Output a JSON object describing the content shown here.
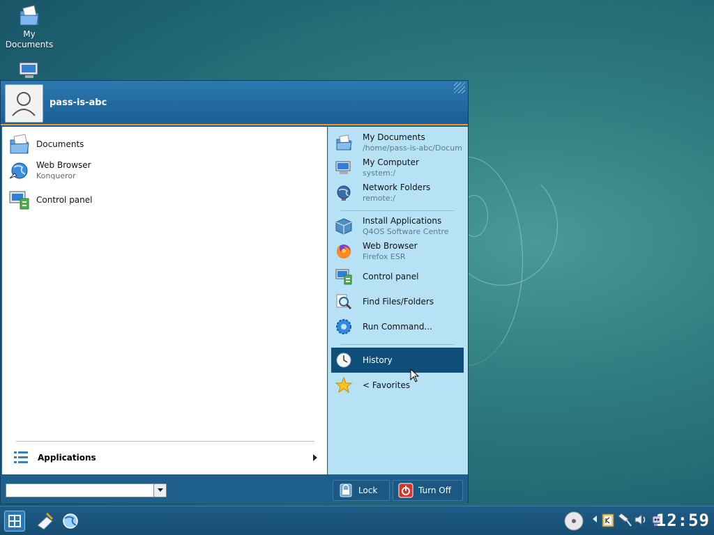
{
  "desktop": {
    "icons": [
      {
        "label_line1": "My",
        "label_line2": "Documents"
      }
    ]
  },
  "menu": {
    "username": "pass-is-abc",
    "left_items": [
      {
        "label": "Documents",
        "sub": ""
      },
      {
        "label": "Web Browser",
        "sub": "Konqueror"
      },
      {
        "label": "Control panel",
        "sub": ""
      }
    ],
    "applications_label": "Applications",
    "right_items": [
      {
        "label": "My Documents",
        "sub": "/home/pass-is-abc/Docum"
      },
      {
        "label": "My Computer",
        "sub": "system:/"
      },
      {
        "label": "Network Folders",
        "sub": "remote:/"
      },
      {
        "label": "Install Applications",
        "sub": "Q4OS Software Centre"
      },
      {
        "label": "Web Browser",
        "sub": "Firefox ESR"
      },
      {
        "label": "Control panel",
        "sub": ""
      },
      {
        "label": "Find Files/Folders",
        "sub": ""
      },
      {
        "label": "Run Command...",
        "sub": ""
      },
      {
        "label": "History",
        "sub": ""
      },
      {
        "label": "<  Favorites",
        "sub": ""
      }
    ],
    "search": {
      "value": "",
      "placeholder": ""
    },
    "lock_label": "Lock",
    "turn_off_label": "Turn Off"
  },
  "taskbar": {
    "clock": "12:59"
  },
  "colors": {
    "menu_blue": "#1f5f8b",
    "right_pane": "#b7e2f6",
    "highlight": "#0f4f7a",
    "header_accent": "#e89a2e"
  }
}
